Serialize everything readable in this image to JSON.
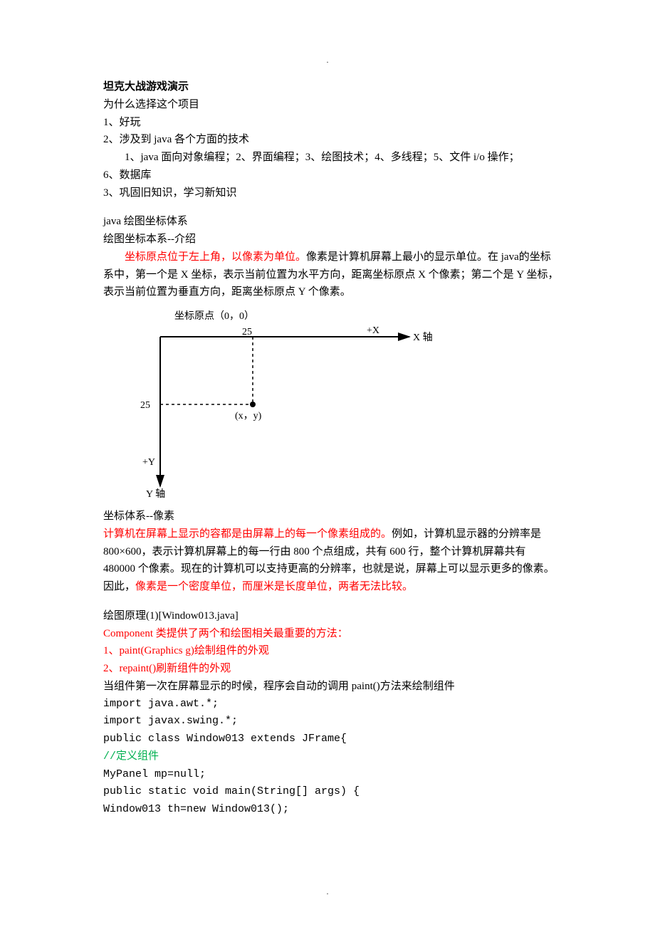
{
  "title": "坦克大战游戏演示",
  "intro": {
    "q": "为什么选择这个项目",
    "p1": "1、好玩",
    "p2": "2、涉及到 java 各个方面的技术",
    "p2sub": "1、java 面向对象编程；2、界面编程；3、绘图技术；4、多线程；5、文件 i/o 操作；",
    "p2sub2": "6、数据库",
    "p3": "3、巩固旧知识，学习新知识"
  },
  "sec1": {
    "h1": "java 绘图坐标体系",
    "h2": "绘图坐标本系--介绍",
    "red": "坐标原点位于左上角，以像素为单位。",
    "rest": "像素是计算机屏幕上最小的显示单位。在 java的坐标系中，第一个是 X 坐标，表示当前位置为水平方向，距离坐标原点 X 个像素；第二个是 Y 坐标，表示当前位置为垂直方向，距离坐标原点 Y 个像素。"
  },
  "diagram": {
    "origin": "坐标原点（0，0）",
    "xaxis": "X 轴",
    "yaxis": "Y 轴",
    "plusx": "+X",
    "plusy": "+Y",
    "t25a": "25",
    "t25b": "25",
    "xy": "(x，y)"
  },
  "sec2": {
    "h": "坐标体系--像素",
    "r1": "计算机在屏幕上显示的容都是由屏幕上的每一个像素组成的。",
    "t1": "例如，计算机显示器的分辨率是 800×600，表示计算机屏幕上的每一行由 800 个点组成，共有 600 行，整个计算机屏幕共有 480000 个像素。现在的计算机可以支持更高的分辨率，也就是说，屏幕上可以显示更多的像素。因此，",
    "r2": "像素是一个密度单位，而厘米是长度单位，两者无法比较。"
  },
  "sec3": {
    "h": "绘图原理(1)[Window013.java]",
    "r1": "Component 类提供了两个和绘图相关最重要的方法：",
    "r2": "1、paint(Graphics g)绘制组件的外观",
    "r3": "2、repaint()刷新组件的外观",
    "t1": "当组件第一次在屏幕显示的时候，程序会自动的调用 paint()方法来绘制组件"
  },
  "code": {
    "l1": "import java.awt.*;",
    "l2": "import javax.swing.*;",
    "l3": "public class Window013 extends JFrame{",
    "l4": "//定义组件",
    "l5": "MyPanel mp=null;",
    "l6": "public static void main(String[] args) {",
    "l7": "Window013 th=new Window013();"
  }
}
